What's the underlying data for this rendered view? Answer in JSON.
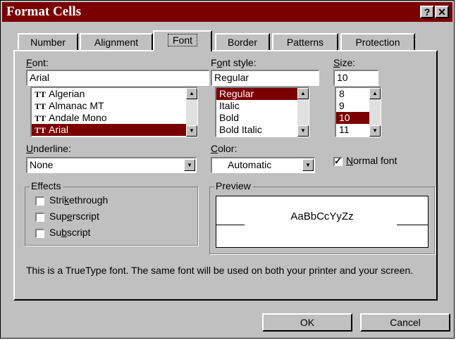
{
  "window": {
    "title": "Format Cells",
    "help_glyph": "?",
    "close_glyph": "✕"
  },
  "tabs": [
    {
      "label": "Number"
    },
    {
      "label": "Alignment"
    },
    {
      "label": "Font"
    },
    {
      "label": "Border"
    },
    {
      "label": "Patterns"
    },
    {
      "label": "Protection"
    }
  ],
  "font": {
    "label": "Font:",
    "label_u": "F",
    "label_rest": "ont:",
    "value": "Arial",
    "options": [
      "Algerian",
      "Almanac MT",
      "Andale Mono",
      "Arial"
    ],
    "selected": "Arial"
  },
  "font_style": {
    "label_pre": "F",
    "label_u": "o",
    "label_rest": "nt style:",
    "value": "Regular",
    "options": [
      "Regular",
      "Italic",
      "Bold",
      "Bold Italic"
    ],
    "selected": "Regular"
  },
  "size": {
    "label_u": "S",
    "label_rest": "ize:",
    "value": "10",
    "options": [
      "8",
      "9",
      "10",
      "11"
    ],
    "selected": "10"
  },
  "underline": {
    "label_u": "U",
    "label_rest": "nderline:",
    "value": "None"
  },
  "color": {
    "label_u": "C",
    "label_rest": "olor:",
    "value": "Automatic"
  },
  "normal_font": {
    "label_u": "N",
    "label_rest": "ormal font",
    "checked": true
  },
  "effects": {
    "legend": "Effects",
    "strikethrough": {
      "pre": "Stri",
      "u": "k",
      "rest": "ethrough",
      "checked": false
    },
    "superscript": {
      "pre": "Sup",
      "u": "e",
      "rest": "rscript",
      "checked": false
    },
    "subscript": {
      "pre": "Su",
      "u": "b",
      "rest": "script",
      "checked": false
    }
  },
  "preview": {
    "legend": "Preview",
    "sample": "AaBbCcYyZz"
  },
  "info_text": "This is a TrueType font.  The same font will be used on both your printer and your screen.",
  "buttons": {
    "ok": "OK",
    "cancel": "Cancel"
  },
  "icons": {
    "truetype": "truetype-icon",
    "up": "▲",
    "down": "▼"
  },
  "colors": {
    "titlebar": "#7a0000",
    "selection": "#7a0000",
    "face": "#c0c0c0"
  }
}
